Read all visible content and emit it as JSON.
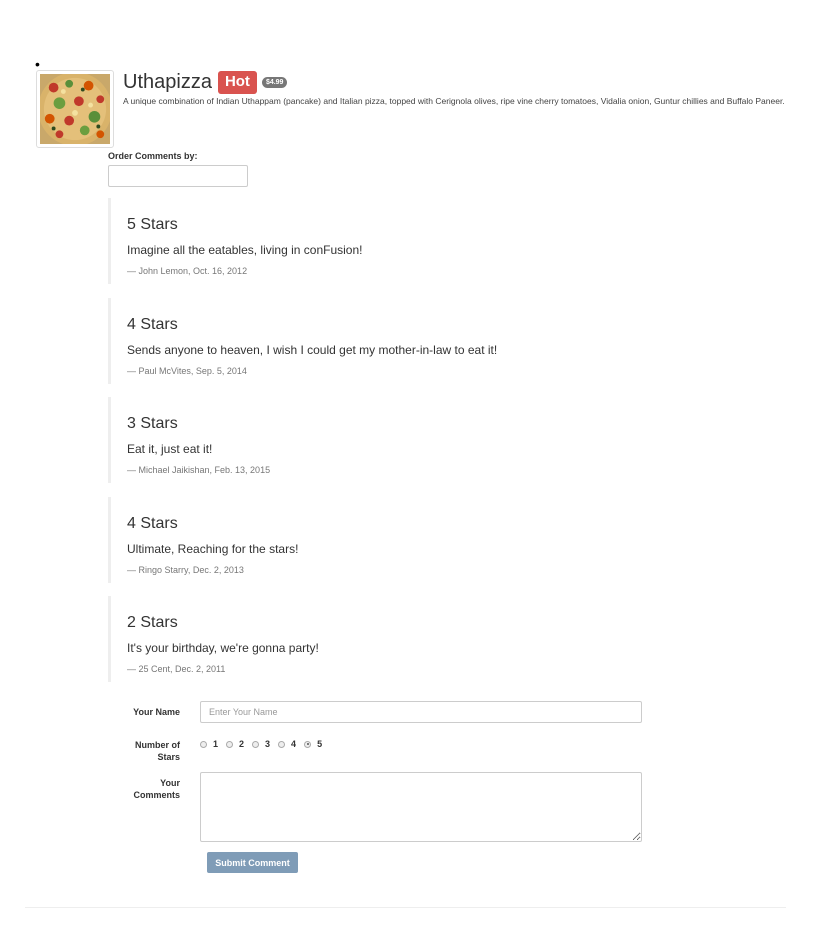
{
  "dish": {
    "name": "Uthapizza",
    "label": "Hot",
    "price": "$4.99",
    "description": "A unique combination of Indian Uthappam (pancake) and Italian pizza, topped with Cerignola olives, ripe vine cherry tomatoes, Vidalia onion, Guntur chillies and Buffalo Paneer.",
    "image_alt": "Uthapizza"
  },
  "order": {
    "label": "Order Comments by:",
    "value": ""
  },
  "comments": [
    {
      "rating": "5 Stars",
      "text": "Imagine all the eatables, living in conFusion!",
      "footer": "— John Lemon, Oct. 16, 2012"
    },
    {
      "rating": "4 Stars",
      "text": "Sends anyone to heaven, I wish I could get my mother-in-law to eat it!",
      "footer": "— Paul McVites, Sep. 5, 2014"
    },
    {
      "rating": "3 Stars",
      "text": "Eat it, just eat it!",
      "footer": "— Michael Jaikishan, Feb. 13, 2015"
    },
    {
      "rating": "4 Stars",
      "text": "Ultimate, Reaching for the stars!",
      "footer": "— Ringo Starry, Dec. 2, 2013"
    },
    {
      "rating": "2 Stars",
      "text": "It's your birthday, we're gonna party!",
      "footer": "— 25 Cent, Dec. 2, 2011"
    }
  ],
  "form": {
    "name_label": "Your Name",
    "name_placeholder": "Enter Your Name",
    "stars_label_1": "Number of",
    "stars_label_2": "Stars",
    "stars": [
      "1",
      "2",
      "3",
      "4",
      "5"
    ],
    "selected_star": "5",
    "comments_label_1": "Your",
    "comments_label_2": "Comments",
    "submit_label": "Submit Comment"
  },
  "colors": {
    "hot_label": "#d9534f",
    "price_badge": "#777777",
    "submit_button": "#7f9cb7"
  }
}
